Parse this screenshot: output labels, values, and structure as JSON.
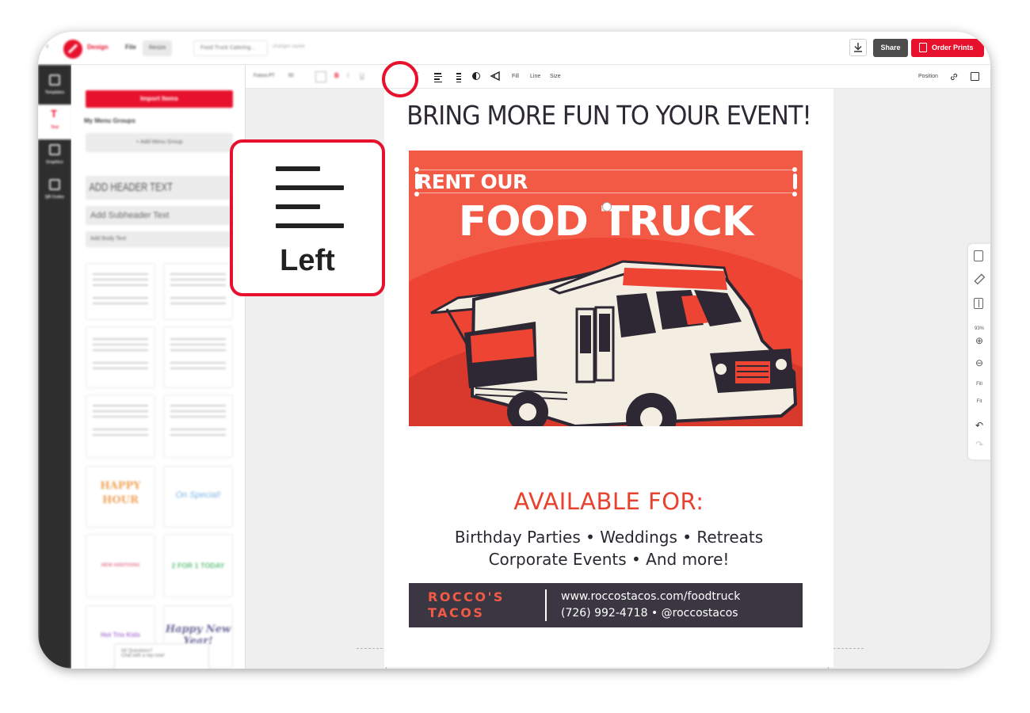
{
  "topbar": {
    "brand": "Design",
    "file_menu": "File",
    "resize_label": "Resize",
    "file_name": "Food Truck Catering...",
    "saved_status": "changes saved",
    "share_label": "Share",
    "order_label": "Order Prints",
    "accent_color": "#e8112d"
  },
  "rail": {
    "items": [
      {
        "label": "Templates",
        "icon": "template-icon"
      },
      {
        "label": "Text",
        "icon": "text-icon"
      },
      {
        "label": "Graphics",
        "icon": "graphics-icon"
      },
      {
        "label": "QR Codes",
        "icon": "qr-code-icon"
      }
    ]
  },
  "panel": {
    "import_label": "Import Items",
    "groups_label": "My Menu Groups",
    "add_group_label": "+ Add Menu Group",
    "header_text": "ADD HEADER TEXT",
    "subheader_text": "Add Subheader Text",
    "body_text": "Add Body Text",
    "tiles": [
      {
        "text": "HAPPY HOUR",
        "color": "#f0a357"
      },
      {
        "text": "On Special!",
        "color": "#7bb3e6"
      },
      {
        "text": "NEW ADDITIONS",
        "color": "#e57c95"
      },
      {
        "text": "2 FOR 1 TODAY",
        "color": "#66c27d"
      },
      {
        "text": "Hot Trio Kids",
        "color": "#b07ad6"
      },
      {
        "text": "Happy New Year!",
        "color": "#6a6a9a"
      }
    ],
    "help_title": "Hi! Questions?",
    "help_sub": "Chat with a rep now!"
  },
  "toolbar": {
    "font_name": "Futura PT",
    "font_size": "50",
    "fill_label": "Fill",
    "line_label": "Line",
    "size_label": "Size",
    "position_label": "Position"
  },
  "poster": {
    "headline": "BRING MORE FUN TO YOUR EVENT!",
    "rent": "RENT OUR",
    "title": "FOOD TRUCK",
    "available": "AVAILABLE FOR:",
    "events_line1": "Birthday Parties • Weddings • Retreats",
    "events_line2": "Corporate Events • And more!",
    "brand_line1": "ROCCO'S",
    "brand_line2": "TACOS",
    "url": "www.roccostacos.com/foodtruck",
    "phone_social": "(726) 992-4718  •  @roccostacos"
  },
  "zoom": {
    "percent": "93%",
    "fill_label": "Fill",
    "fit_label": "Fit"
  },
  "callout": {
    "label": "Left"
  }
}
